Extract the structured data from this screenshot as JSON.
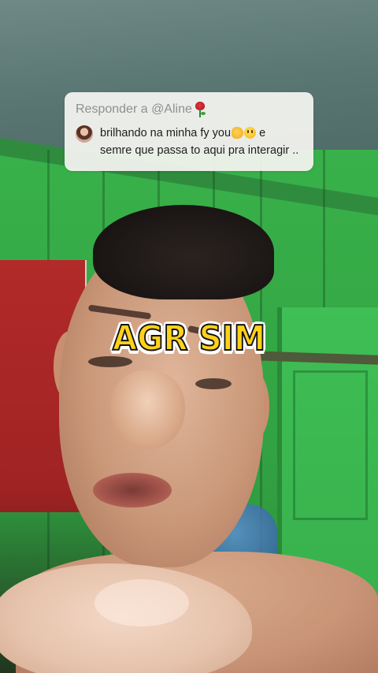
{
  "reply": {
    "prefix": "Responder a @Aline",
    "header_icon": "rose-icon",
    "avatar_icon": "avatar",
    "comment_line1": "brilhando na minha fy you",
    "comment_line1_icons": [
      "clap-icon",
      "smile-icon"
    ],
    "comment_line1_suffix": " e",
    "comment_line2": "semre que passa to aqui pra interagir .."
  },
  "caption": {
    "text": "AGR SIM",
    "fill_color": "#ffd11a",
    "outline_color": "#ffffff"
  },
  "colors": {
    "wall": "#39b14a",
    "card_bg": "#f3f3f0",
    "reply_prefix": "#8f8f8f"
  }
}
